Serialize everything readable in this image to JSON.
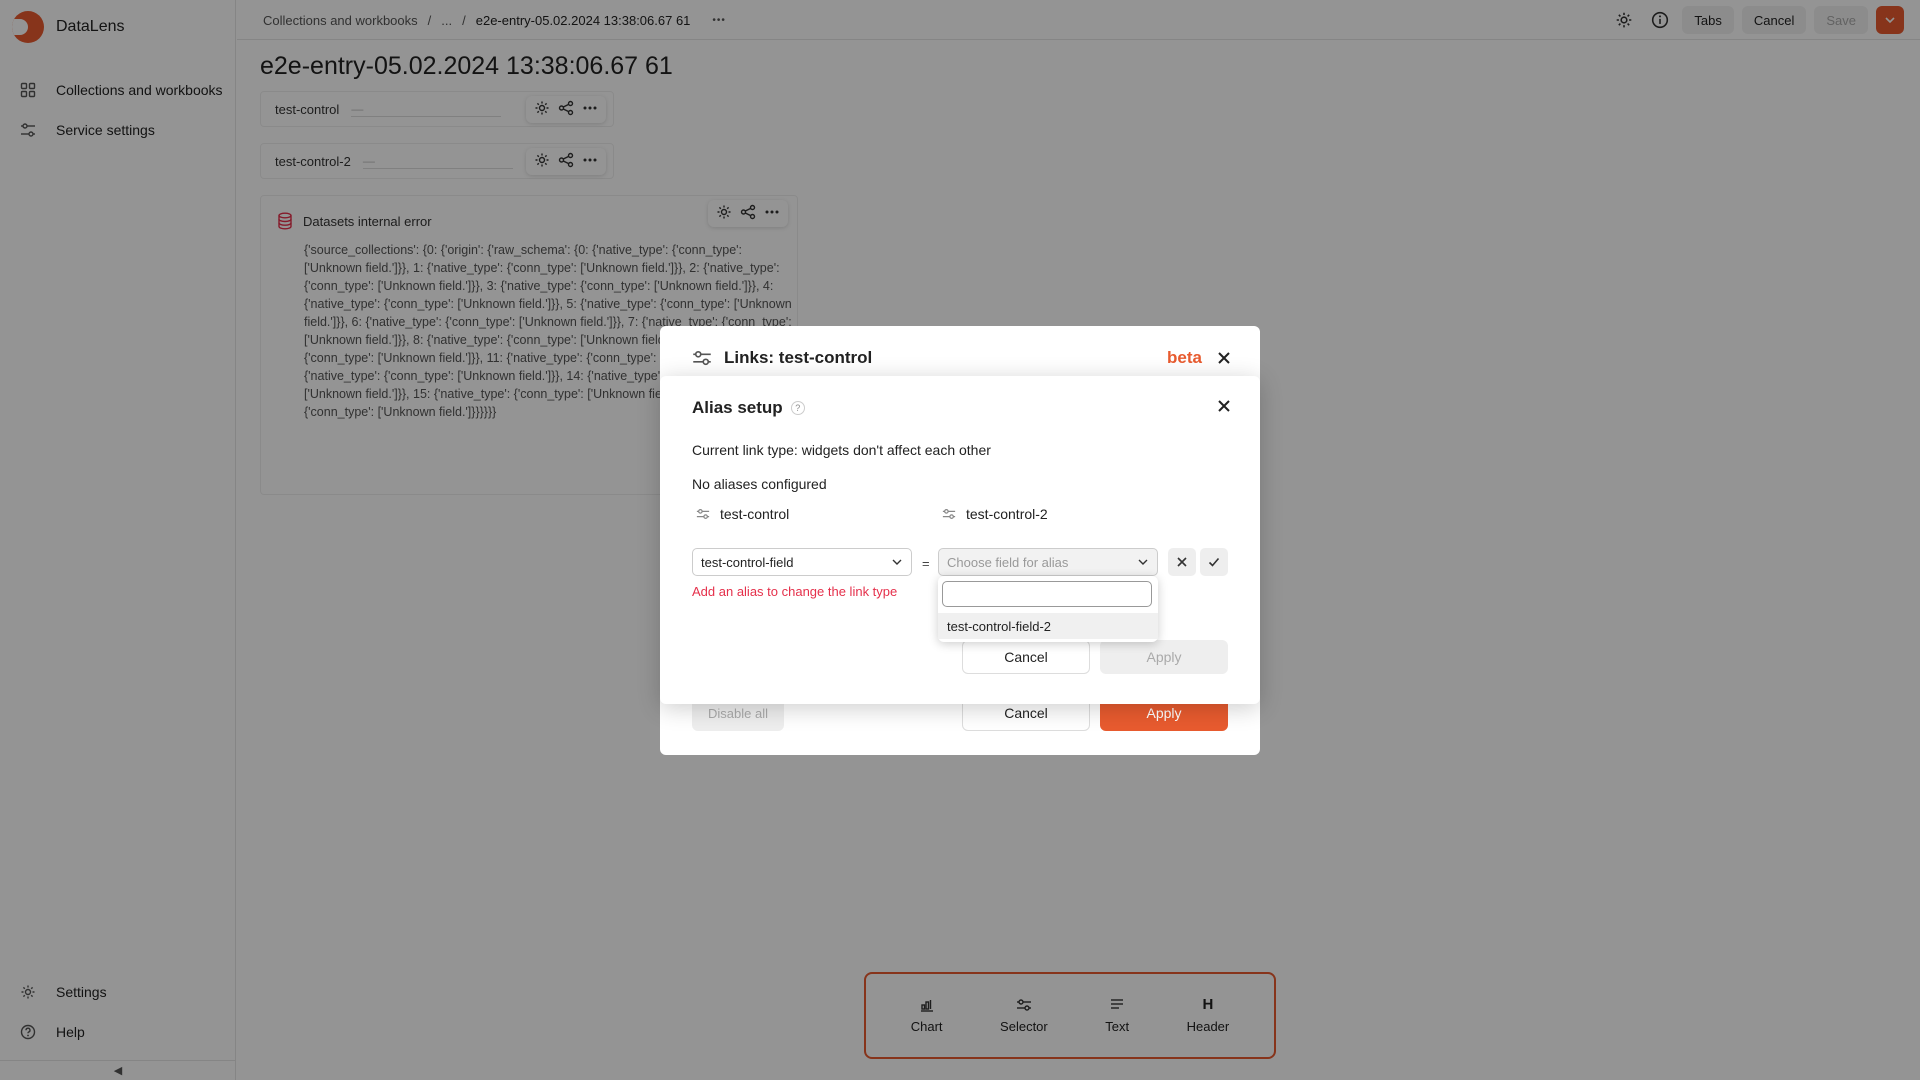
{
  "app": {
    "name": "DataLens"
  },
  "sidebar": {
    "items": [
      {
        "label": "Collections and workbooks",
        "icon": "grid-icon"
      },
      {
        "label": "Service settings",
        "icon": "sliders-icon"
      }
    ],
    "bottom": [
      {
        "label": "Settings",
        "icon": "gear-icon"
      },
      {
        "label": "Help",
        "icon": "help-circle-icon"
      }
    ],
    "collapse_glyph": "◀"
  },
  "header": {
    "breadcrumbs": [
      "Collections and workbooks",
      "...",
      "e2e-entry-05.02.2024 13:38:06.67 61"
    ],
    "separator": "/",
    "more_glyph": "•••",
    "tabs_label": "Tabs",
    "cancel_label": "Cancel",
    "save_label": "Save"
  },
  "page": {
    "title": "e2e-entry-05.02.2024 13:38:06.67 61"
  },
  "widgets": {
    "control1": {
      "label": "test-control",
      "value": "—"
    },
    "control2": {
      "label": "test-control-2",
      "value": "—"
    },
    "error": {
      "title": "Datasets internal error",
      "body": "{'source_collections': {0: {'origin': {'raw_schema': {0: {'native_type': {'conn_type': ['Unknown field.']}}, 1: {'native_type': {'conn_type': ['Unknown field.']}}, 2: {'native_type': {'conn_type': ['Unknown field.']}}, 3: {'native_type': {'conn_type': ['Unknown field.']}}, 4: {'native_type': {'conn_type': ['Unknown field.']}}, 5: {'native_type': {'conn_type': ['Unknown field.']}}, 6: {'native_type': {'conn_type': ['Unknown field.']}}, 7: {'native_type': {'conn_type': ['Unknown field.']}}, 8: {'native_type': {'conn_type': ['Unknown field.']}}, 10: {'native_type': {'conn_type': ['Unknown field.']}}, 11: {'native_type': {'conn_type': ['Unknown field.']}}, 13: {'native_type': {'conn_type': ['Unknown field.']}}, 14: {'native_type': {'conn_type': ['Unknown field.']}}, 15: {'native_type': {'conn_type': ['Unknown field.']}}, 17: {'native_type': {'conn_type': ['Unknown field.']}}}}}}"
    }
  },
  "add_toolbar": {
    "items": [
      {
        "label": "Chart",
        "icon": "chart-icon"
      },
      {
        "label": "Selector",
        "icon": "selector-icon"
      },
      {
        "label": "Text",
        "icon": "text-icon"
      },
      {
        "label": "Header",
        "icon": "header-icon",
        "glyph": "H"
      }
    ]
  },
  "links_dialog": {
    "title": "Links: test-control",
    "badge": "beta",
    "disable_all_label": "Disable all",
    "cancel_label": "Cancel",
    "apply_label": "Apply"
  },
  "alias_dialog": {
    "title": "Alias setup",
    "help_glyph": "?",
    "link_type_text": "Current link type: widgets don't affect each other",
    "no_aliases_text": "No aliases configured",
    "left_widget": "test-control",
    "right_widget": "test-control-2",
    "left_field_value": "test-control-field",
    "equals": "=",
    "right_field_placeholder": "Choose field for alias",
    "error_text": "Add an alias to change the link type",
    "cancel_label": "Cancel",
    "apply_label": "Apply"
  },
  "dropdown": {
    "search_value": "",
    "options": [
      "test-control-field-2"
    ]
  },
  "colors": {
    "accent": "#e85b2f",
    "error": "#e5304b",
    "overlay": "rgba(0,0,0,0.42)"
  }
}
